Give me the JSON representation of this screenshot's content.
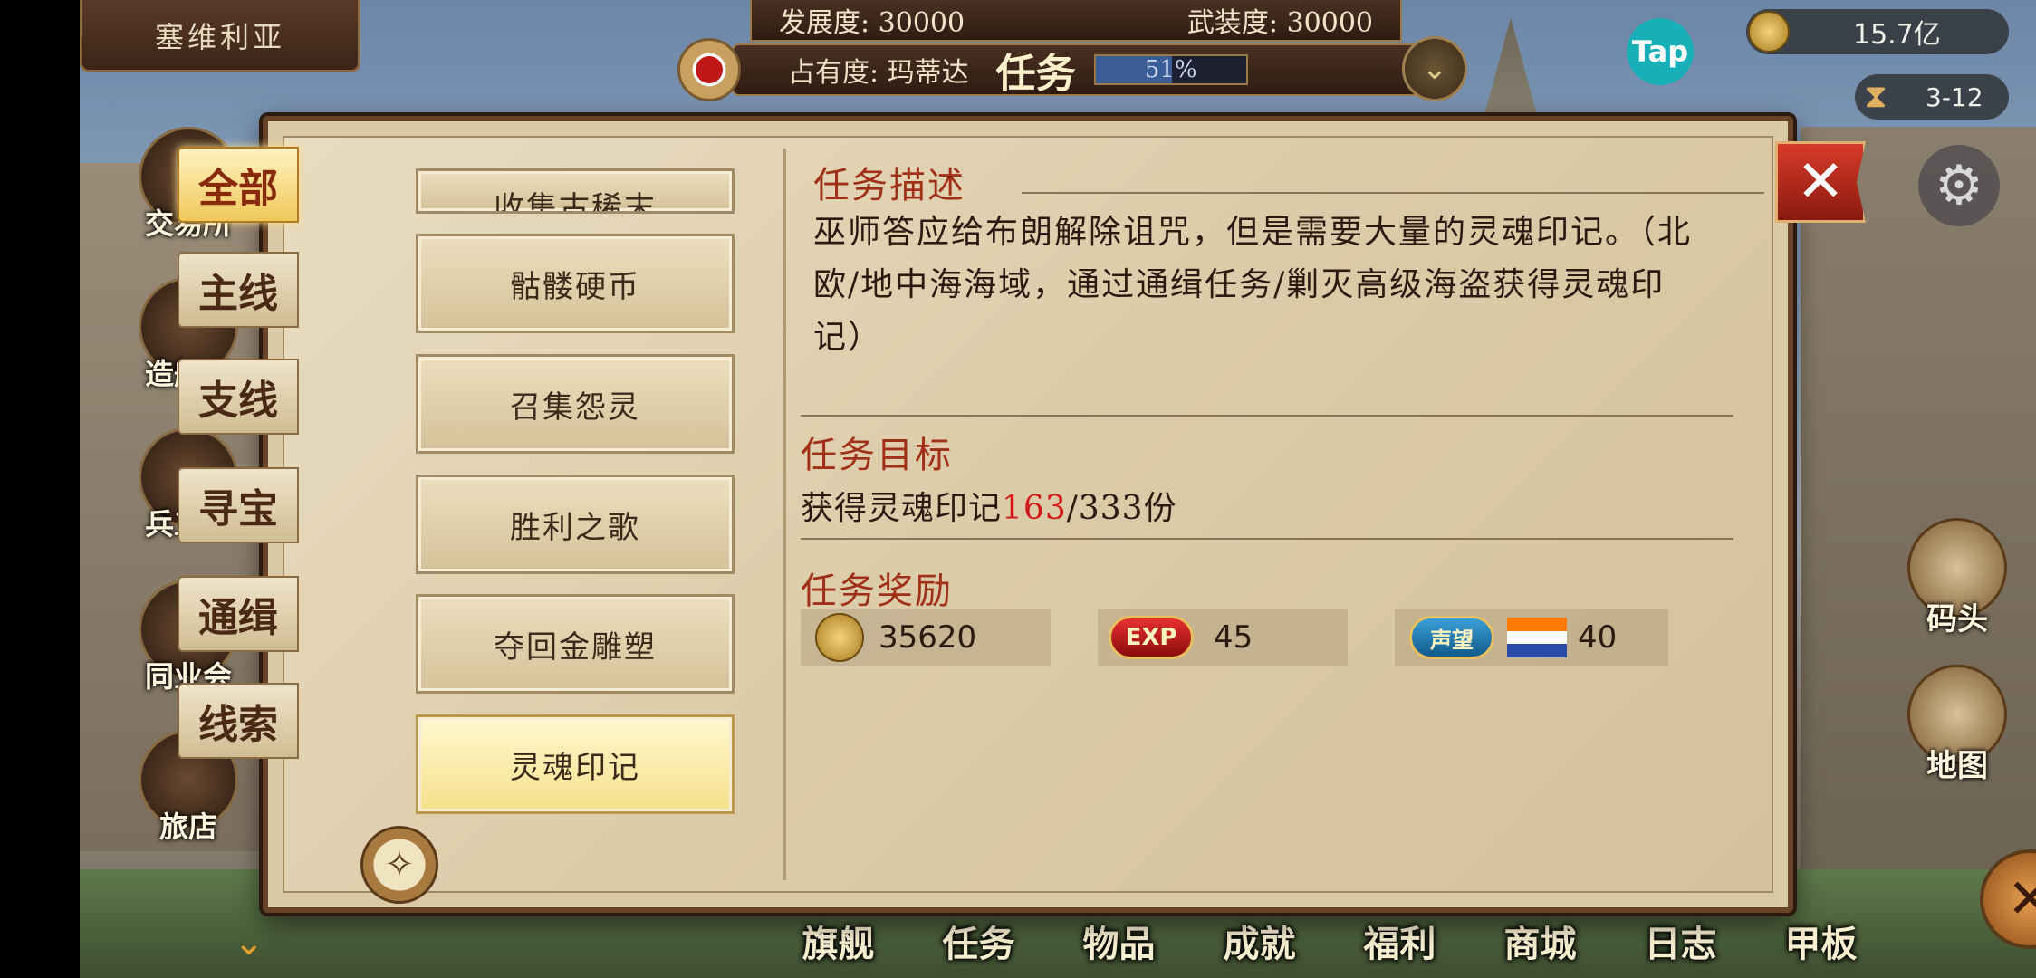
{
  "city": {
    "name": "塞维利亚"
  },
  "top_status": {
    "development": "发展度: 30000",
    "armament": "武装度: 30000",
    "occupancy": "占有度: 玛蒂达",
    "screen_title": "任务",
    "progress_text": "51%",
    "progress_value": 0.51,
    "shield_icon": "chevron-down-icon"
  },
  "tap_label": "Tap",
  "currency": {
    "gold": "15.7亿",
    "time": "3-12"
  },
  "city_buttons": [
    {
      "label": "交易所",
      "icon": "scales-icon"
    },
    {
      "label": "造船厂",
      "icon": "ship-icon"
    },
    {
      "label": "兵工厂",
      "icon": "cannon-icon"
    },
    {
      "label": "同业会",
      "icon": "anchor-icon"
    },
    {
      "label": "旅店",
      "icon": "inn-icon"
    }
  ],
  "right_buttons": [
    {
      "label": "码头",
      "icon": "dock-icon"
    },
    {
      "label": "地图",
      "icon": "map-icon"
    }
  ],
  "bottom_nav": [
    "旗舰",
    "任务",
    "物品",
    "成就",
    "福利",
    "商城",
    "日志",
    "甲板"
  ],
  "categories": [
    {
      "label": "全部",
      "active": true
    },
    {
      "label": "主线",
      "active": false
    },
    {
      "label": "支线",
      "active": false
    },
    {
      "label": "寻宝",
      "active": false
    },
    {
      "label": "通缉",
      "active": false
    },
    {
      "label": "线索",
      "active": false
    }
  ],
  "quests": [
    {
      "label": "收集古稀末",
      "active": false
    },
    {
      "label": "骷髅硬币",
      "active": false
    },
    {
      "label": "召集怨灵",
      "active": false
    },
    {
      "label": "胜利之歌",
      "active": false
    },
    {
      "label": "夺回金雕塑",
      "active": false
    },
    {
      "label": "灵魂印记",
      "active": true
    }
  ],
  "detail": {
    "desc_title": "任务描述",
    "description": "巫师答应给布朗解除诅咒，但是需要大量的灵魂印记。（北欧/地中海海域，通过通缉任务/剿灭高级海盗获得灵魂印记）",
    "goal_title": "任务目标",
    "goal_prefix": "获得灵魂印记",
    "goal_current": "163",
    "goal_suffix": "/333份",
    "reward_title": "任务奖励",
    "reward_gold": "35620",
    "reward_exp_label": "EXP",
    "reward_exp": "45",
    "reward_rep_label": "声望",
    "reward_rep": "40",
    "flag_colors": [
      "#ff7a00",
      "#ffffff",
      "#2a4aa8"
    ]
  },
  "colors": {
    "accent_red": "#d01818",
    "title_red": "#a03018"
  }
}
